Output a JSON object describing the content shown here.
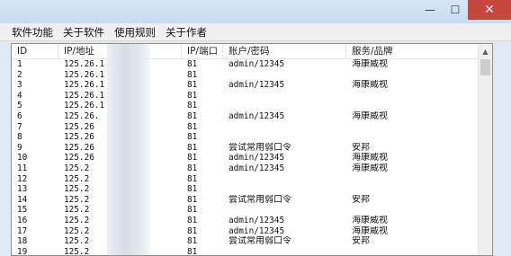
{
  "window": {
    "minimize_glyph": "—",
    "maximize_glyph": "☐",
    "close_glyph": "✕"
  },
  "menu": [
    "软件功能",
    "关于软件",
    "使用规则",
    "关于作者"
  ],
  "columns": [
    "ID",
    "IP/地址",
    "IP/端口",
    "账户/密码",
    "服务/品牌"
  ],
  "rows": [
    {
      "id": "1",
      "ip": "125.26.1",
      "port": "81",
      "account": "admin/12345",
      "service": "海康威视"
    },
    {
      "id": "2",
      "ip": "125.26.1",
      "port": "81",
      "account": "",
      "service": ""
    },
    {
      "id": "3",
      "ip": "125.26.1",
      "port": "81",
      "account": "admin/12345",
      "service": "海康威视"
    },
    {
      "id": "4",
      "ip": "125.26.1",
      "port": "81",
      "account": "",
      "service": ""
    },
    {
      "id": "5",
      "ip": "125.26.1",
      "port": "81",
      "account": "",
      "service": ""
    },
    {
      "id": "6",
      "ip": "125.26.",
      "port": "81",
      "account": "admin/12345",
      "service": "海康威视"
    },
    {
      "id": "7",
      "ip": "125.26",
      "port": "81",
      "account": "",
      "service": ""
    },
    {
      "id": "8",
      "ip": "125.26",
      "port": "81",
      "account": "",
      "service": ""
    },
    {
      "id": "9",
      "ip": "125.26",
      "port": "81",
      "account": "尝试常用弱口令",
      "service": "安邦"
    },
    {
      "id": "10",
      "ip": "125.26",
      "port": "81",
      "account": "admin/12345",
      "service": "海康威视"
    },
    {
      "id": "11",
      "ip": "125.2",
      "port": "81",
      "account": "admin/12345",
      "service": "海康威视"
    },
    {
      "id": "12",
      "ip": "125.2",
      "port": "81",
      "account": "",
      "service": ""
    },
    {
      "id": "13",
      "ip": "125.2",
      "port": "81",
      "account": "",
      "service": ""
    },
    {
      "id": "14",
      "ip": "125.2",
      "port": "81",
      "account": "尝试常用弱口令",
      "service": "安邦"
    },
    {
      "id": "15",
      "ip": "125.2",
      "port": "81",
      "account": "",
      "service": ""
    },
    {
      "id": "16",
      "ip": "125.2",
      "port": "81",
      "account": "admin/12345",
      "service": "海康威视"
    },
    {
      "id": "17",
      "ip": "125.2",
      "port": "81",
      "account": "admin/12345",
      "service": "海康威视"
    },
    {
      "id": "18",
      "ip": "125.2",
      "port": "81",
      "account": "尝试常用弱口令",
      "service": "安邦"
    },
    {
      "id": "19",
      "ip": "125.2",
      "port": "81",
      "account": "",
      "service": ""
    }
  ]
}
